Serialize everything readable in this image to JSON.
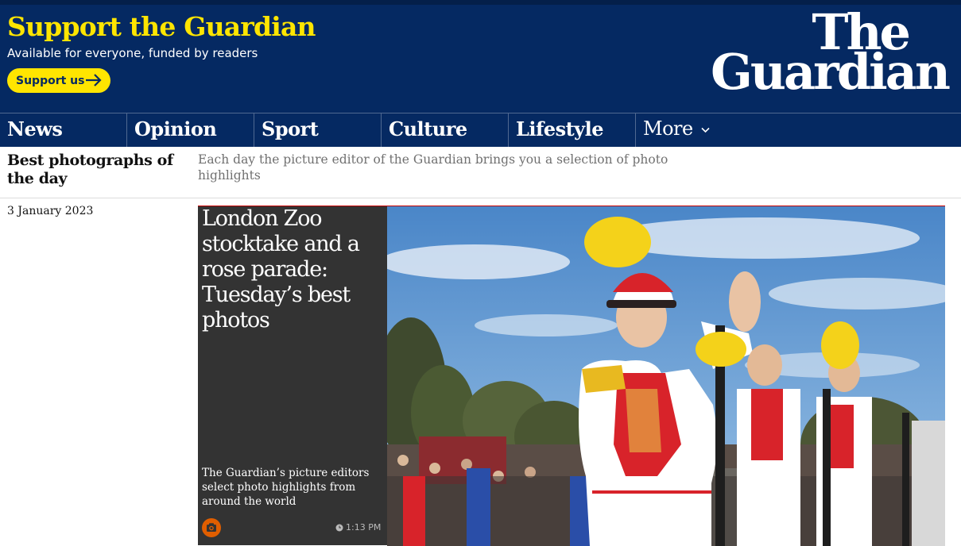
{
  "support": {
    "title": "Support the Guardian",
    "subtitle": "Available for everyone, funded by readers",
    "button_label": "Support us"
  },
  "logo": {
    "line1": "The",
    "line2": "Guardian"
  },
  "nav": {
    "items": [
      {
        "label": "News"
      },
      {
        "label": "Opinion"
      },
      {
        "label": "Sport"
      },
      {
        "label": "Culture"
      },
      {
        "label": "Lifestyle"
      }
    ],
    "more_label": "More"
  },
  "series": {
    "title": "Best photographs of the day",
    "description": "Each day the picture editor of the Guardian brings you a selection of photo highlights"
  },
  "date": "3 January 2023",
  "card": {
    "headline": "London Zoo stocktake and a rose parade: Tuesday’s best photos",
    "standfirst": "The Guardian’s picture editors select photo highlights from around the world",
    "time": "1:13 PM",
    "icon": "camera-icon"
  },
  "colors": {
    "brand_blue": "#052962",
    "support_yellow": "#ffe500",
    "card_bg": "#333333",
    "accent_red": "#c70000",
    "camera_badge": "#e05e00"
  }
}
